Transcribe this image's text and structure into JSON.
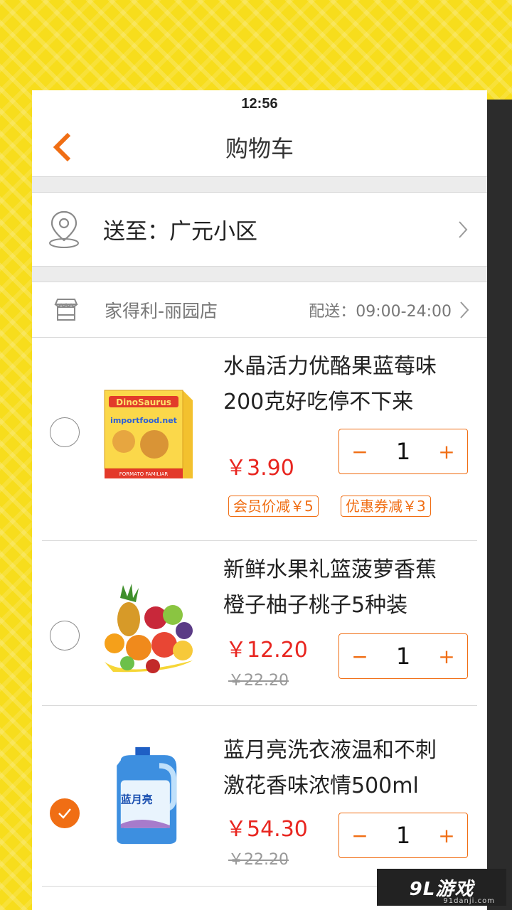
{
  "status_bar": {
    "time": "12:56"
  },
  "header": {
    "title": "购物车"
  },
  "address": {
    "text": "送至：广元小区"
  },
  "store": {
    "name": "家得利-丽园店",
    "delivery": "配送：09:00-24:00"
  },
  "items": [
    {
      "name_line1": "水晶活力优酪果蓝莓味",
      "name_line2": "200克好吃停不下来",
      "price": "￥3.90",
      "quantity": "1",
      "selected": false,
      "tags": [
        "会员价减￥5",
        "优惠券减￥3"
      ],
      "image_icon": "cookie-box-image"
    },
    {
      "name_line1": "新鲜水果礼篮菠萝香蕉",
      "name_line2": "橙子柚子桃子5种装",
      "price": "￥12.20",
      "original_price": "￥22.20",
      "quantity": "1",
      "selected": false,
      "image_icon": "fruit-basket-image"
    },
    {
      "name_line1": "蓝月亮洗衣液温和不刺",
      "name_line2": "激花香味浓情500ml",
      "price": "￥54.30",
      "original_price": "￥22.20",
      "quantity": "1",
      "selected": true,
      "image_icon": "detergent-bottle-image"
    }
  ],
  "stepper": {
    "minus": "−",
    "plus": "+"
  },
  "watermark": {
    "text": "9L游戏",
    "sub": "91danji.com"
  },
  "colors": {
    "accent": "#f06e14",
    "price": "#e8251f",
    "background": "#f7dd1c"
  }
}
